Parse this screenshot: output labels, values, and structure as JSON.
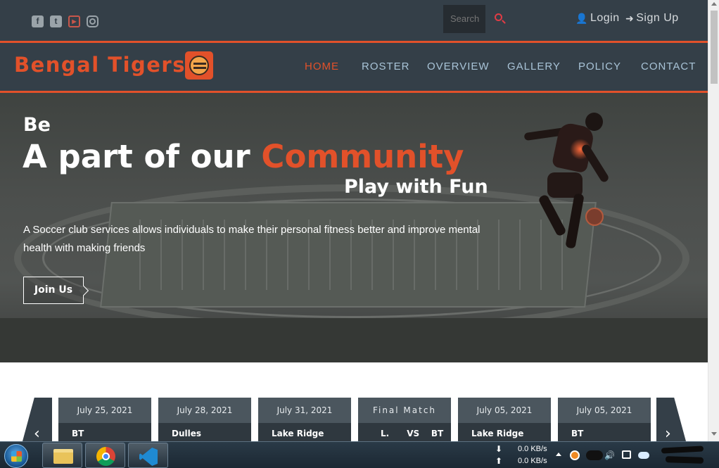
{
  "topbar": {
    "social": [
      {
        "name": "facebook-icon",
        "glyph": "f"
      },
      {
        "name": "twitter-icon",
        "glyph": "t"
      },
      {
        "name": "youtube-icon",
        "glyph": "▶"
      },
      {
        "name": "instagram-icon",
        "glyph": ""
      }
    ],
    "search_placeholder": "Search",
    "login_label": "Login",
    "signup_label": "Sign Up"
  },
  "navbar": {
    "brand": "Bengal Tigers",
    "items": [
      "HOME",
      "ROSTER",
      "OVERVIEW",
      "GALLERY",
      "POLICY",
      "CONTACT"
    ],
    "active_index": 0
  },
  "hero": {
    "be": "Be",
    "title_prefix": "A part of our ",
    "title_accent": "Community",
    "subtitle": "Play with Fun",
    "description": "A Soccer club services allows individuals to make their personal fitness better and improve mental health with making friends",
    "cta": "Join Us"
  },
  "matches": [
    {
      "date": "July 25, 2021",
      "team": "BT"
    },
    {
      "date": "July 28, 2021",
      "team": "Dulles"
    },
    {
      "date": "July 31, 2021",
      "team": "Lake Ridge"
    },
    {
      "date": "Final Match",
      "team": "L.      VS    BT"
    },
    {
      "date": "July 05, 2021",
      "team": "Lake Ridge"
    },
    {
      "date": "July 05, 2021",
      "team": "BT"
    }
  ],
  "taskbar": {
    "download_speed": "0.0 KB/s",
    "upload_speed": "0.0 KB/s"
  },
  "colors": {
    "accent": "#e2512a",
    "bar": "#343f48",
    "nav_text": "#a9c4d8"
  }
}
